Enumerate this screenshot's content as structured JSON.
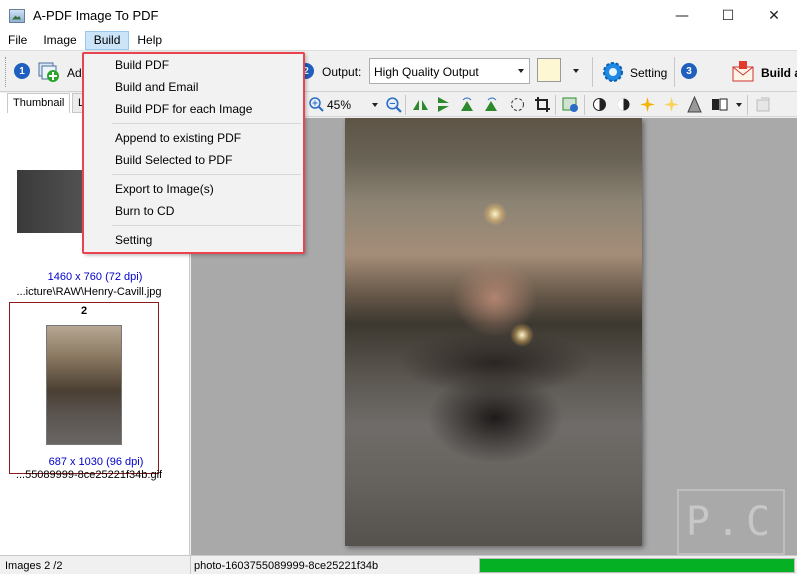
{
  "window": {
    "title": "A-PDF Image To PDF",
    "minimize": "—",
    "maximize": "☐",
    "close": "✕"
  },
  "menubar": {
    "items": [
      "File",
      "Image",
      "Build",
      "Help"
    ]
  },
  "toolbar": {
    "step1": "1",
    "add_label": "Ad",
    "step2": "2",
    "output_label": "Output:",
    "output_value": "High Quality Output",
    "setting_label": "Setting",
    "step3": "3",
    "build_label": "Build a",
    "bg_color": "#fdf7d3"
  },
  "left_panel": {
    "tab_thumbnail": "Thumbnail",
    "tab_list": "L",
    "items": [
      {
        "dims": "1460 x 760 (72 dpi)",
        "path": "...icture\\RAW\\Henry-Cavill.jpg"
      },
      {
        "number": "2",
        "dims": "687 x 1030 (96 dpi)",
        "path": "...55089999-8ce25221f34b.gif"
      }
    ]
  },
  "viewer": {
    "zoom": "45%",
    "watermark_text": "P.C"
  },
  "status": {
    "images": "Images 2 /2",
    "file": "photo-1603755089999-8ce25221f34b",
    "progress_pct": 100,
    "progress_color": "#06b025"
  },
  "build_menu": {
    "items": [
      "Build PDF",
      "Build and Email",
      "Build PDF for each Image",
      "Append to existing PDF",
      "Build Selected to PDF",
      "Export to Image(s)",
      "Burn to CD",
      "Setting"
    ],
    "highlight_color": "#e8434f"
  },
  "colors": {
    "accent_blue": "#1f5fbf",
    "menu_active_bg": "#cce4f7",
    "selection_border": "#8b1a1a"
  }
}
